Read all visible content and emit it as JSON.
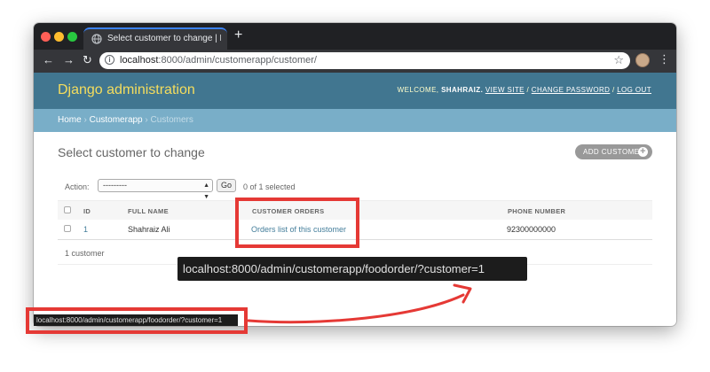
{
  "browser": {
    "tab_title": "Select customer to change | Djang",
    "url_host": "localhost",
    "url_path": ":8000/admin/customerapp/customer/",
    "new_tab_icon": "plus-icon",
    "colors": {
      "tab_accent": "#3b82f6",
      "chrome_bg": "#202124"
    }
  },
  "admin": {
    "branding": "Django administration",
    "welcome_text": "WELCOME,",
    "username": "SHAHRAIZ.",
    "view_site": "VIEW SITE",
    "change_password": "CHANGE PASSWORD",
    "logout": "LOG OUT",
    "sep": "/",
    "colors": {
      "header_bg": "#417690",
      "branding": "#f5dd5d",
      "breadcrumbs_bg": "#79aec8"
    }
  },
  "breadcrumbs": {
    "home": "Home",
    "app": "Customerapp",
    "current": "Customers",
    "sep": "›"
  },
  "content": {
    "title": "Select customer to change",
    "add_button": "ADD CUSTOMER",
    "action_label": "Action:",
    "action_selected": "---------",
    "go_button": "Go",
    "selected_count": "0 of 1 selected",
    "columns": [
      "ID",
      "FULL NAME",
      "CUSTOMER ORDERS",
      "PHONE NUMBER"
    ],
    "rows": [
      {
        "id": "1",
        "full_name": "Shahraiz Ali",
        "orders_link": "Orders list of this customer",
        "phone": "92300000000"
      }
    ],
    "paginator": "1 customer"
  },
  "annotations": {
    "tooltip_url": "localhost:8000/admin/customerapp/foodorder/?customer=1",
    "status_url": "localhost:8000/admin/customerapp/foodorder/?customer=1",
    "highlight_color": "#e53935"
  }
}
